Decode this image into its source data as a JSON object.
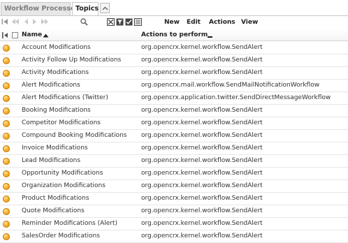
{
  "tabs": [
    {
      "label": "Workflow Processes",
      "active": false
    },
    {
      "label": "Topics",
      "active": true
    }
  ],
  "toolbar": {
    "menus": [
      "New",
      "Edit",
      "Actions",
      "View"
    ]
  },
  "table": {
    "columns": {
      "name": "Name",
      "actions": "Actions to perform"
    },
    "rows": [
      {
        "name": "Account Modifications",
        "action": "org.opencrx.kernel.workflow.SendAlert"
      },
      {
        "name": "Activity Follow Up Modifications",
        "action": "org.opencrx.kernel.workflow.SendAlert"
      },
      {
        "name": "Activity Modifications",
        "action": "org.opencrx.kernel.workflow.SendAlert"
      },
      {
        "name": "Alert Modifications",
        "action": "org.opencrx.mail.workflow.SendMailNotificationWorkflow"
      },
      {
        "name": "Alert Modifications (Twitter)",
        "action": "org.opencrx.application.twitter.SendDirectMessageWorkflow"
      },
      {
        "name": "Booking Modifications",
        "action": "org.opencrx.kernel.workflow.SendAlert"
      },
      {
        "name": "Competitor Modifications",
        "action": "org.opencrx.kernel.workflow.SendAlert"
      },
      {
        "name": "Compound Booking Modifications",
        "action": "org.opencrx.kernel.workflow.SendAlert"
      },
      {
        "name": "Invoice Modifications",
        "action": "org.opencrx.kernel.workflow.SendAlert"
      },
      {
        "name": "Lead Modifications",
        "action": "org.opencrx.kernel.workflow.SendAlert"
      },
      {
        "name": "Opportunity Modifications",
        "action": "org.opencrx.kernel.workflow.SendAlert"
      },
      {
        "name": "Organization Modifications",
        "action": "org.opencrx.kernel.workflow.SendAlert"
      },
      {
        "name": "Product Modifications",
        "action": "org.opencrx.kernel.workflow.SendAlert"
      },
      {
        "name": "Quote Modifications",
        "action": "org.opencrx.kernel.workflow.SendAlert"
      },
      {
        "name": "Reminder Modifications (Alert)",
        "action": "org.opencrx.kernel.workflow.SendAlert"
      },
      {
        "name": "SalesOrder Modifications",
        "action": "org.opencrx.kernel.workflow.SendAlert"
      }
    ]
  },
  "colors": {
    "tab_border": "#c8c8c8",
    "status_dot": "#f7b736"
  }
}
